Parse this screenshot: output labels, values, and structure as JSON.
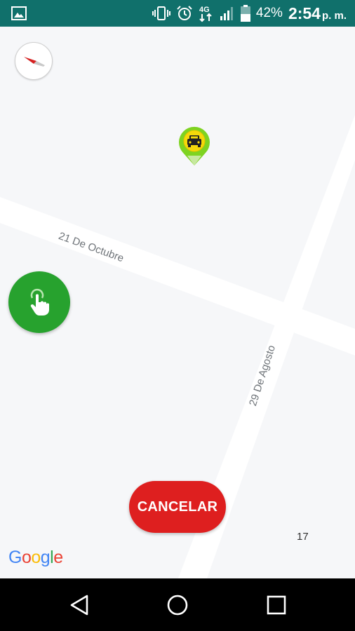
{
  "status_bar": {
    "notification_icon": "image-icon",
    "icons": [
      "vibrate-icon",
      "alarm-icon",
      "4g-data-icon",
      "signal-icon",
      "battery-icon"
    ],
    "network_label": "4G",
    "battery_percent": "42%",
    "time": "2:54",
    "time_suffix": "p. m."
  },
  "map": {
    "street_1": "21 De Octubre",
    "street_2": "29 De Agosto",
    "number_label": "17",
    "compass_icon": "compass-icon",
    "taxi_marker_icon": "taxi-icon",
    "attribution": "Google",
    "colors": {
      "background": "#f6f7f9",
      "road": "#ffffff",
      "marker_ring": "#7ed321",
      "marker_inner": "#f5d90a"
    }
  },
  "fab": {
    "icon": "tap-hand-icon",
    "color": "#27a22e"
  },
  "actions": {
    "cancel_label": "CANCELAR",
    "cancel_color": "#de1f1f"
  },
  "nav_bar": {
    "back_icon": "back-icon",
    "home_icon": "home-icon",
    "recents_icon": "recents-icon"
  },
  "colors": {
    "status_bar": "#10706b"
  }
}
